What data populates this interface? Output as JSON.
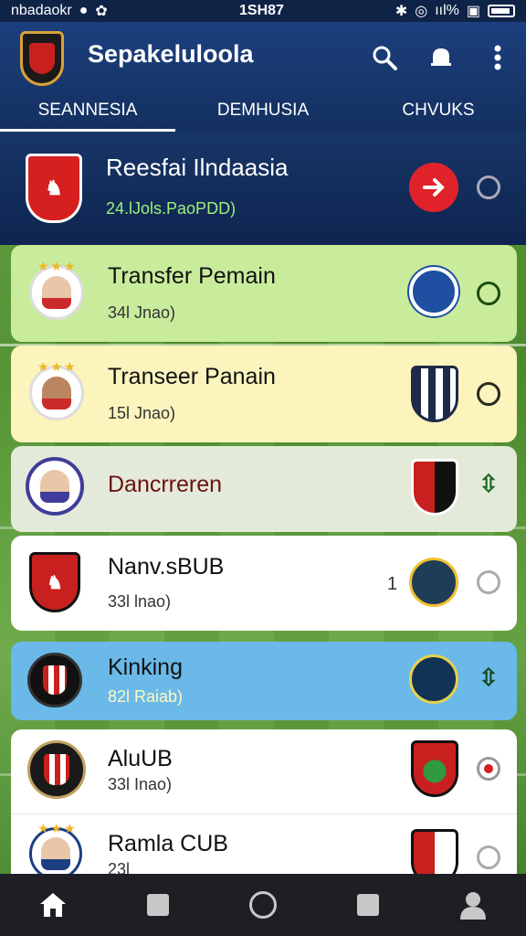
{
  "status_bar": {
    "left_text": "nbadaokr",
    "time": "1SH87",
    "right_text": "ııl%"
  },
  "app_bar": {
    "title": "Sepakeluloola",
    "tabs": [
      "SEANNESIA",
      "DEMHUSIA",
      "CHVUKS"
    ],
    "active_tab": 0
  },
  "list": [
    {
      "title": "Reesfai Ilndaasia",
      "subtitle": "24.lJols.PaoPDD)",
      "action": "arrow-right"
    },
    {
      "title": "Transfer Pemain",
      "subtitle": "34l Jnao)",
      "status": "circle-outline"
    },
    {
      "title": "Transeer Panain",
      "subtitle": "15l Jnao)",
      "status": "circle-outline"
    },
    {
      "title": "Dancrreren",
      "subtitle": "",
      "status": "up-down-arrows"
    },
    {
      "title": "Nanv.sBUB",
      "subtitle": "33l lnao)",
      "count": "1",
      "status": "circle-outline"
    },
    {
      "title": "Kinking",
      "subtitle": "82l Raiab)",
      "status": "up-down-arrows"
    },
    {
      "title": "AluUB",
      "subtitle": "33l Inao)",
      "status": "radio-selected"
    },
    {
      "title": "Ramla CUB",
      "subtitle": "23l",
      "status": "circle-outline"
    }
  ],
  "colors": {
    "appbar": "#1c3f7e",
    "accent_red": "#e0222a",
    "row_green": "#c9ec9c",
    "row_yellow": "#fbf4bd",
    "row_blue": "#6ab9e9"
  },
  "bottom_nav": [
    "home-icon",
    "square-icon",
    "circle-icon",
    "square-icon",
    "profile-icon"
  ]
}
